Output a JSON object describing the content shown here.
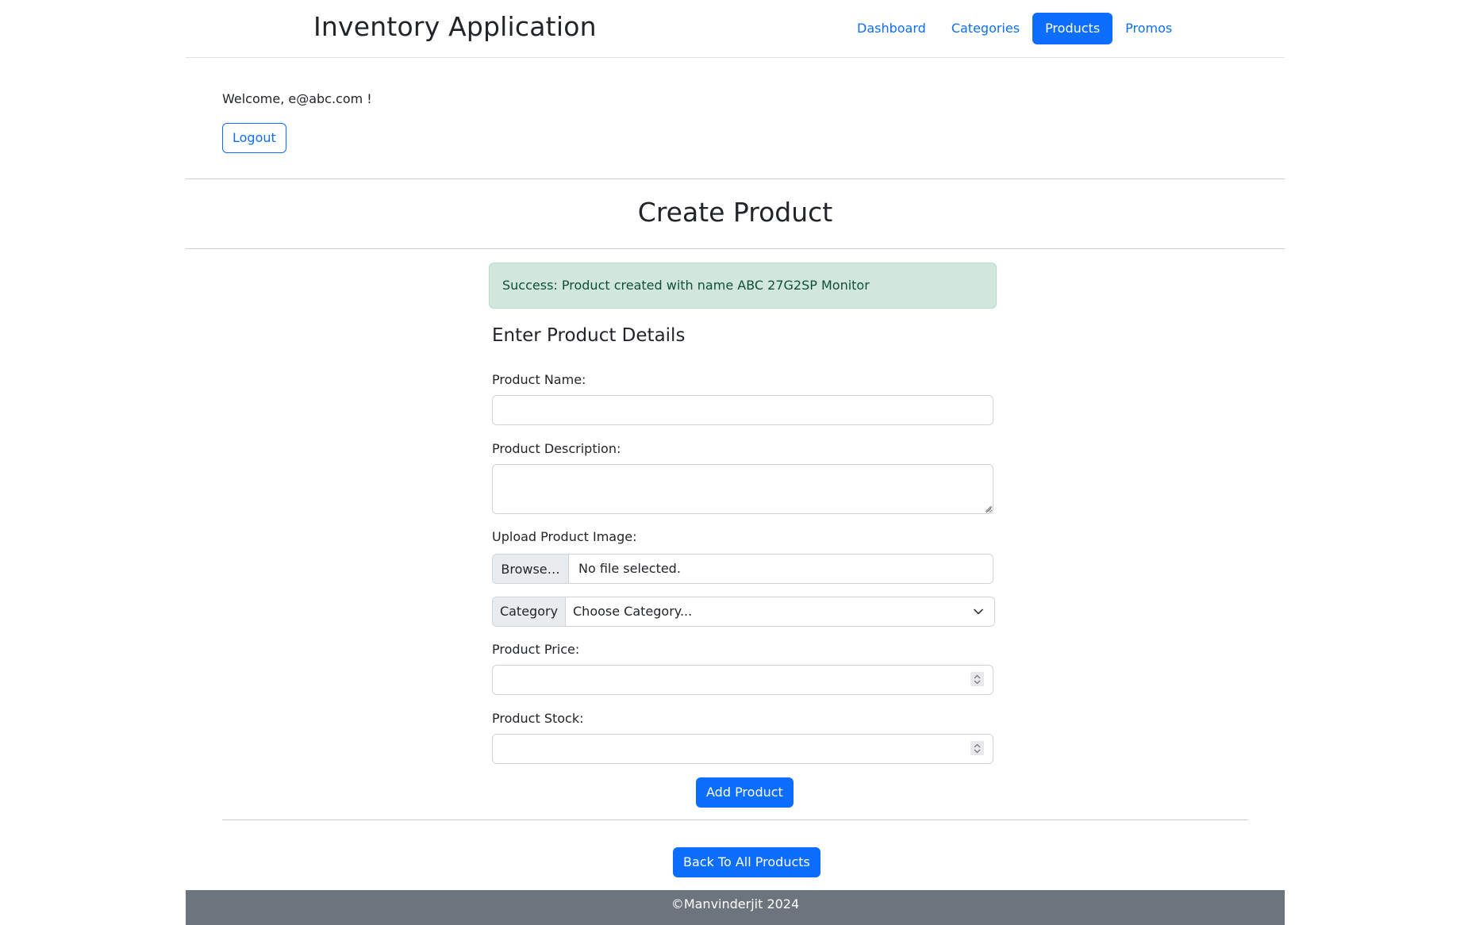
{
  "header": {
    "title": "Inventory Application",
    "nav": [
      {
        "label": "Dashboard",
        "active": false
      },
      {
        "label": "Categories",
        "active": false
      },
      {
        "label": "Products",
        "active": true
      },
      {
        "label": "Promos",
        "active": false
      }
    ]
  },
  "user": {
    "welcome": "Welcome, e@abc.com !",
    "logout_label": "Logout"
  },
  "page": {
    "title": "Create Product"
  },
  "alert": {
    "type": "success",
    "message": "Success: Product created with name ABC 27G2SP Monitor"
  },
  "form": {
    "section_title": "Enter Product Details",
    "name": {
      "label": "Product Name:",
      "value": ""
    },
    "description": {
      "label": "Product Description:",
      "value": ""
    },
    "image": {
      "label": "Upload Product Image:",
      "button_label": "Browse…",
      "status": "No file selected."
    },
    "category": {
      "addon_label": "Category",
      "selected": "Choose Category..."
    },
    "price": {
      "label": "Product Price:",
      "value": ""
    },
    "stock": {
      "label": "Product Stock:",
      "value": ""
    },
    "submit_label": "Add Product"
  },
  "back_label": "Back To All Products",
  "footer": {
    "text": "©Manvinderjit 2024"
  },
  "colors": {
    "primary": "#0d6efd",
    "success_bg": "#d1e7dd",
    "success_text": "#0f5132",
    "footer_bg": "#6c757d"
  }
}
